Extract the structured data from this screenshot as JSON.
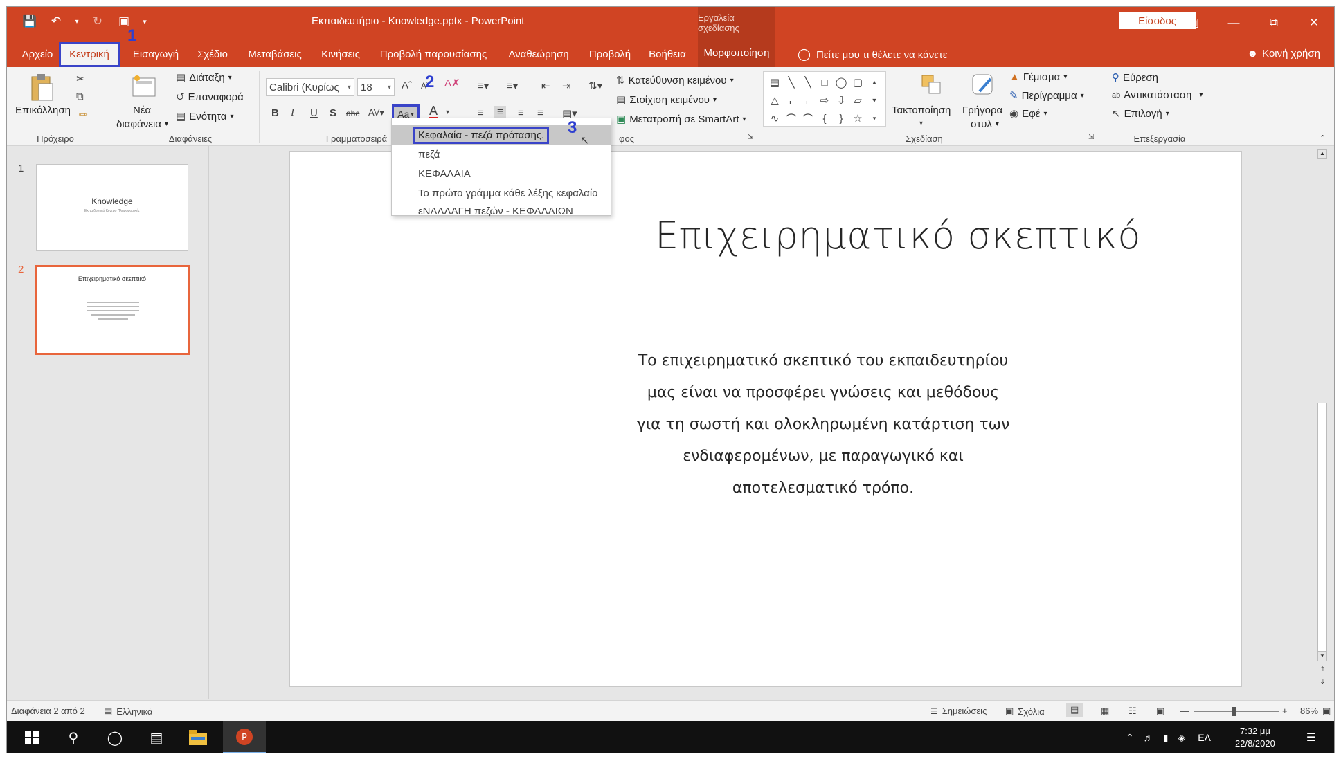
{
  "window": {
    "title": "Εκπαιδευτήριο - Knowledge.pptx - PowerPoint",
    "contextual_tools_label": "Εργαλεία σχεδίασης",
    "signin_label": "Είσοδος"
  },
  "tabs": [
    {
      "label": "Αρχείο"
    },
    {
      "label": "Κεντρική"
    },
    {
      "label": "Εισαγωγή"
    },
    {
      "label": "Σχέδιο"
    },
    {
      "label": "Μεταβάσεις"
    },
    {
      "label": "Κινήσεις"
    },
    {
      "label": "Προβολή παρουσίασης"
    },
    {
      "label": "Αναθεώρηση"
    },
    {
      "label": "Προβολή"
    },
    {
      "label": "Βοήθεια"
    },
    {
      "label": "Μορφοποίηση"
    }
  ],
  "tell_me": "Πείτε μου τι θέλετε να κάνετε",
  "share": "Κοινή χρήση",
  "callouts": [
    "1",
    "2",
    "3"
  ],
  "ribbon": {
    "clipboard": {
      "paste": "Επικόλληση",
      "group": "Πρόχειρο"
    },
    "slides": {
      "new_slide_l1": "Νέα",
      "new_slide_l2": "διαφάνεια",
      "layout": "Διάταξη",
      "reset": "Επαναφορά",
      "section": "Ενότητα",
      "group": "Διαφάνειες"
    },
    "font": {
      "name": "Calibri (Κυρίως",
      "size": "18",
      "change_case": "Aa",
      "group": "Γραμματοσειρά"
    },
    "paragraph": {
      "text_direction": "Κατεύθυνση κειμένου",
      "align_text": "Στοίχιση κειμένου",
      "smartart": "Μετατροπή σε SmartArt",
      "group_tail": "φος"
    },
    "drawing": {
      "arrange": "Τακτοποίηση",
      "quick_styles_l1": "Γρήγορα",
      "quick_styles_l2": "στυλ",
      "fill": "Γέμισμα",
      "outline": "Περίγραμμα",
      "effects": "Εφέ",
      "group": "Σχεδίαση"
    },
    "editing": {
      "find": "Εύρεση",
      "replace": "Αντικατάσταση",
      "select": "Επιλογή",
      "group": "Επεξεργασία"
    }
  },
  "change_case_menu": [
    {
      "label": "Κεφαλαία - πεζά πρότασης."
    },
    {
      "label": "πεζά"
    },
    {
      "label": "ΚΕΦΑΛΑΙΑ"
    },
    {
      "label": "Το πρώτο γράμμα κάθε λέξης κεφαλαίο"
    },
    {
      "label": "εΝΑΛΛΑΓΗ πεζών - ΚΕΦΑΛΑΙΩΝ"
    }
  ],
  "thumbnails": [
    {
      "number": "1",
      "title": "Knowledge",
      "subtitle": "Εκπαιδευτικό Κέντρο Πληροφορικής"
    },
    {
      "number": "2",
      "title": "Επιχειρηματικό σκεπτικό"
    }
  ],
  "slide": {
    "title": "Επιχειρηματικό σκεπτικό",
    "body_lines": [
      "Το επιχειρηματικό σκεπτικό του εκπαιδευτηρίου",
      "μας είναι να προσφέρει γνώσεις και μεθόδους",
      "για τη σωστή και ολοκληρωμένη κατάρτιση των",
      "ενδιαφερομένων, με παραγωγικό και",
      "αποτελεσματικό τρόπο."
    ]
  },
  "status": {
    "slide_counter": "Διαφάνεια 2 από 2",
    "language": "Ελληνικά",
    "notes": "Σημειώσεις",
    "comments": "Σχόλια",
    "zoom": "86%"
  },
  "taskbar": {
    "lang": "ΕΛ",
    "time": "7:32 μμ",
    "date": "22/8/2020"
  },
  "colors": {
    "accent": "#d04423",
    "callout": "#2e3fd0"
  }
}
